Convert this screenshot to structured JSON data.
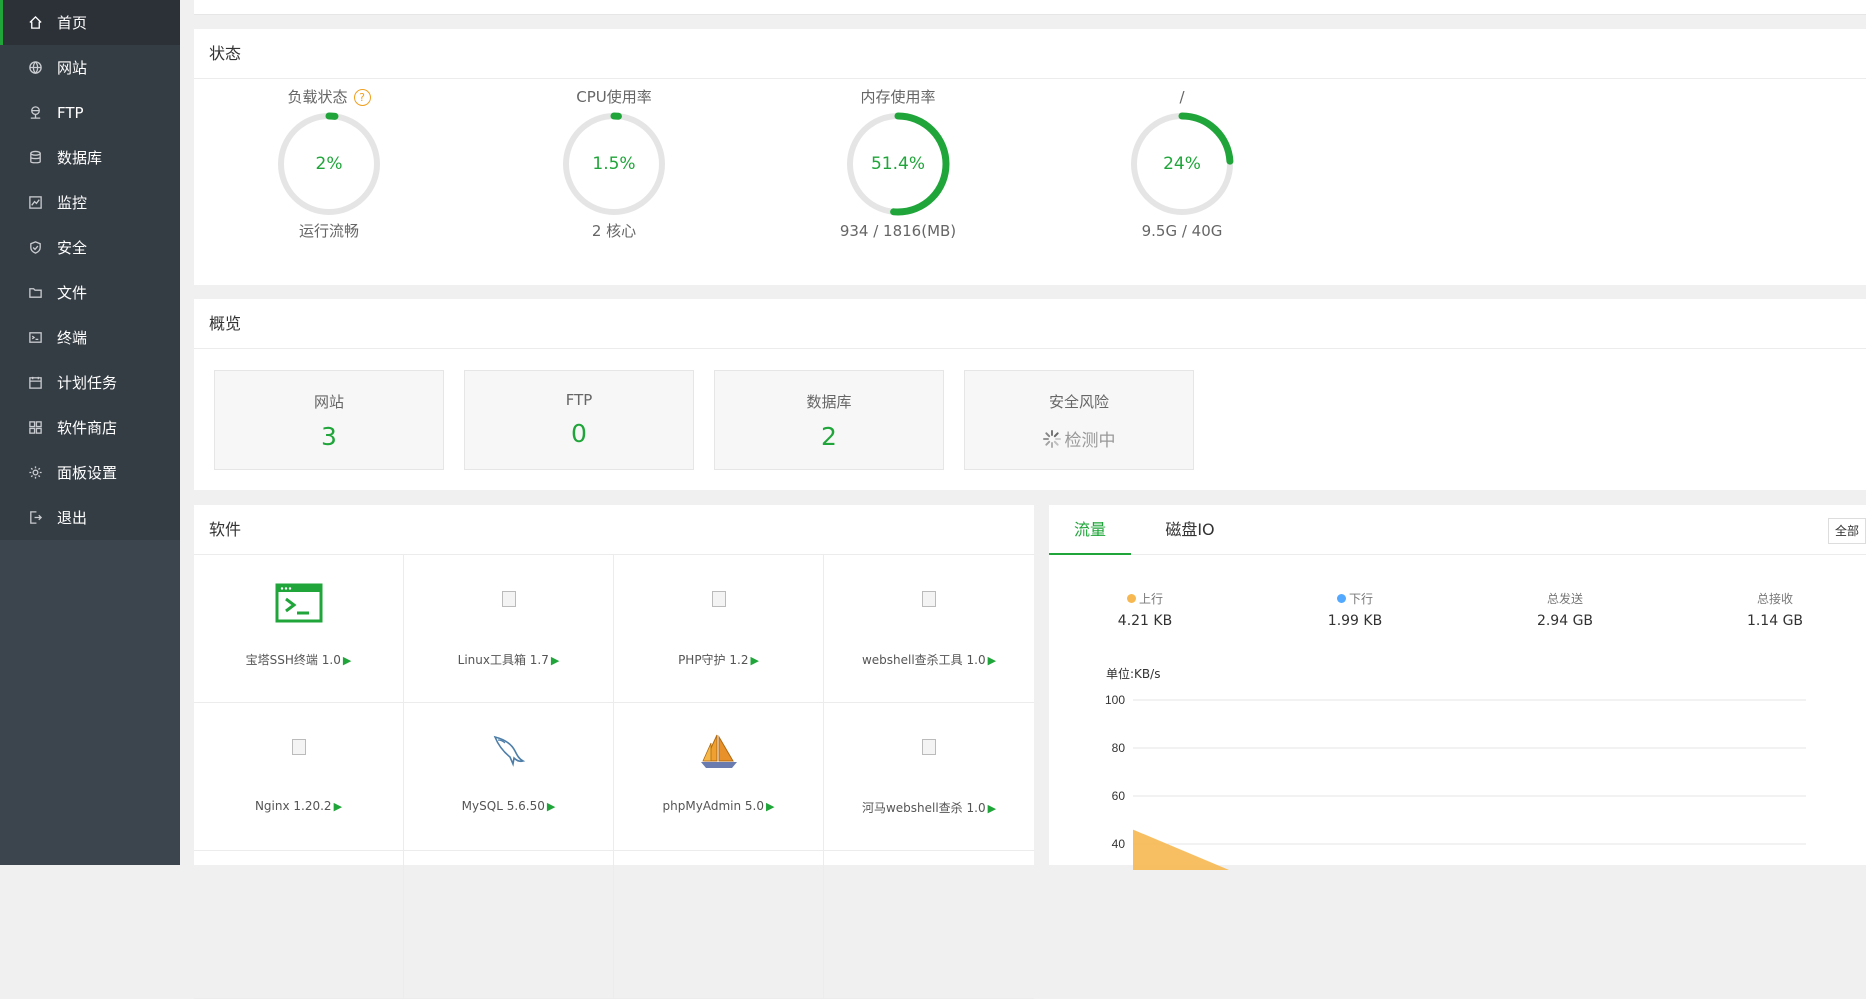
{
  "sidebar": {
    "items": [
      {
        "label": "首页",
        "icon": "home-icon",
        "active": true
      },
      {
        "label": "网站",
        "icon": "globe-icon"
      },
      {
        "label": "FTP",
        "icon": "ftp-icon"
      },
      {
        "label": "数据库",
        "icon": "database-icon"
      },
      {
        "label": "监控",
        "icon": "monitor-icon"
      },
      {
        "label": "安全",
        "icon": "shield-icon"
      },
      {
        "label": "文件",
        "icon": "folder-icon"
      },
      {
        "label": "终端",
        "icon": "terminal-icon"
      },
      {
        "label": "计划任务",
        "icon": "calendar-icon"
      },
      {
        "label": "软件商店",
        "icon": "grid-icon"
      },
      {
        "label": "面板设置",
        "icon": "gear-icon"
      },
      {
        "label": "退出",
        "icon": "logout-icon"
      }
    ]
  },
  "status": {
    "title": "状态",
    "gauges": [
      {
        "label": "负载状态",
        "value": "2%",
        "percent": 2,
        "sub": "运行流畅",
        "has_help": true
      },
      {
        "label": "CPU使用率",
        "value": "1.5%",
        "percent": 1.5,
        "sub": "2 核心"
      },
      {
        "label": "内存使用率",
        "value": "51.4%",
        "percent": 51.4,
        "sub": "934 / 1816(MB)"
      },
      {
        "label": "/",
        "value": "24%",
        "percent": 24,
        "sub": "9.5G / 40G"
      }
    ],
    "help_glyph": "?"
  },
  "overview": {
    "title": "概览",
    "cards": [
      {
        "label": "网站",
        "value": "3"
      },
      {
        "label": "FTP",
        "value": "0"
      },
      {
        "label": "数据库",
        "value": "2"
      },
      {
        "label": "安全风险",
        "pending": "检测中"
      }
    ]
  },
  "software": {
    "title": "软件",
    "items": [
      {
        "name": "宝塔SSH终端 1.0",
        "icon": "terminal-window-icon"
      },
      {
        "name": "Linux工具箱 1.7",
        "icon": "broken-image-icon"
      },
      {
        "name": "PHP守护 1.2",
        "icon": "broken-image-icon"
      },
      {
        "name": "webshell查杀工具 1.0",
        "icon": "broken-image-icon"
      },
      {
        "name": "Nginx 1.20.2",
        "icon": "broken-image-icon"
      },
      {
        "name": "MySQL 5.6.50",
        "icon": "dolphin-icon"
      },
      {
        "name": "phpMyAdmin 5.0",
        "icon": "sailboat-icon"
      },
      {
        "name": "河马webshell查杀 1.0",
        "icon": "broken-image-icon"
      }
    ],
    "play_glyph": "▶"
  },
  "traffic": {
    "tabs": [
      {
        "label": "流量",
        "active": true
      },
      {
        "label": "磁盘IO"
      }
    ],
    "all_button": "全部",
    "stats": [
      {
        "label": "上行",
        "value": "4.21 KB",
        "dot_color": "#f7b851"
      },
      {
        "label": "下行",
        "value": "1.99 KB",
        "dot_color": "#52a9ff"
      },
      {
        "label": "总发送",
        "value": "2.94 GB"
      },
      {
        "label": "总接收",
        "value": "1.14 GB"
      }
    ],
    "unit_label": "单位:KB/s",
    "colors": {
      "upload": "#f7b851",
      "download": "#52a9ff",
      "accent": "#20a53a"
    }
  },
  "chart_data": {
    "type": "area",
    "ylabel": "单位:KB/s",
    "ylim": [
      0,
      100
    ],
    "y_ticks": [
      "100",
      "80",
      "60",
      "40"
    ],
    "series": [
      {
        "name": "上行",
        "color": "#f7b851",
        "x_fraction": [
          0,
          0.39
        ],
        "values": [
          46,
          0
        ]
      }
    ]
  }
}
